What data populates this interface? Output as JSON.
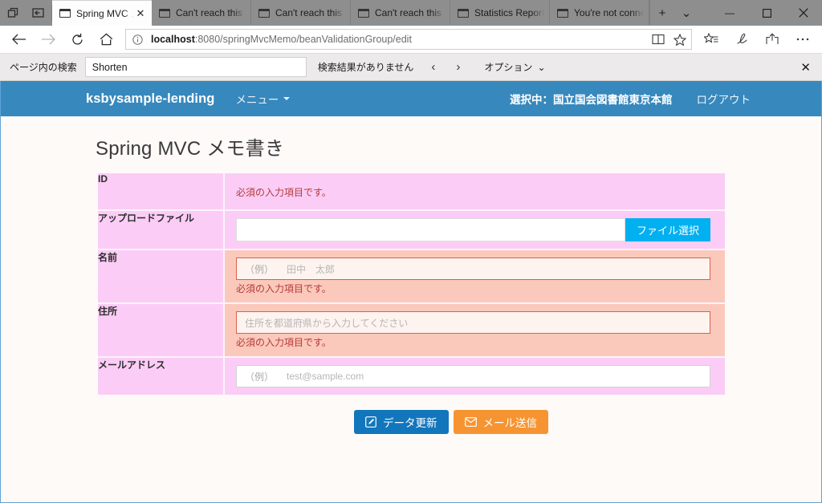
{
  "browser": {
    "system_icons": [
      "restore-window-icon",
      "back-to-tabs-icon"
    ],
    "tabs": [
      {
        "title": "Spring MVC メ",
        "active": true,
        "icon": "page-icon",
        "close_label": "✕"
      },
      {
        "title": "Can't reach this pa",
        "active": false,
        "icon": "page-icon"
      },
      {
        "title": "Can't reach this pa",
        "active": false,
        "icon": "page-icon"
      },
      {
        "title": "Can't reach this pa",
        "active": false,
        "icon": "page-icon"
      },
      {
        "title": "Statistics Report fo",
        "active": false,
        "icon": "page-icon"
      },
      {
        "title": "You're not connec",
        "active": false,
        "icon": "page-icon"
      }
    ],
    "new_tab_label": "+",
    "tab_menu_label": "⌄",
    "window_controls": {
      "minimize": "—",
      "maximize": "❐",
      "close": "✕"
    },
    "nav": {
      "back": "←",
      "forward": "→",
      "refresh": "↻",
      "home": "⌂",
      "info_icon": "ⓘ",
      "url_host": "localhost",
      "url_rest": ":8080/springMvcMemo/beanValidationGroup/edit",
      "reading_view_icon": "book-icon",
      "favorite_icon": "star-icon",
      "favorites_hub_icon": "favorites-hub-icon",
      "notes_icon": "pen-icon",
      "share_icon": "share-icon",
      "settings_icon": "more-icon"
    },
    "find": {
      "label": "ページ内の検索",
      "value": "Shorten",
      "placeholder": "ページ内の検索",
      "status": "検索結果がありません",
      "prev": "‹",
      "next": "›",
      "options_label": "オプション",
      "options_caret": "⌄",
      "close": "✕"
    }
  },
  "app": {
    "brand": "ksbysample-lending",
    "menu_label": "メニュー",
    "selected_library": "選択中：国立国会図書館東京本館",
    "logout_label": "ログアウト",
    "accent_color": "#3788bd"
  },
  "page": {
    "title": "Spring MVC メモ書き",
    "form": {
      "rows": [
        {
          "label": "ID",
          "type": "error-only",
          "error": "必須の入力項目です。"
        },
        {
          "label": "アップロードファイル",
          "type": "file",
          "value": "",
          "button_label": "ファイル選択",
          "button_color": "#00b0f0"
        },
        {
          "label": "名前",
          "type": "text",
          "value": "",
          "placeholder_prefix": "（例）",
          "placeholder": "田中　太郎",
          "error": "必須の入力項目です。",
          "invalid": true
        },
        {
          "label": "住所",
          "type": "text",
          "value": "",
          "placeholder_prefix": "",
          "placeholder": "住所を都道府県から入力してください",
          "error": "必須の入力項目です。",
          "invalid": true
        },
        {
          "label": "メールアドレス",
          "type": "text",
          "value": "",
          "placeholder_prefix": "（例）",
          "placeholder": "test@sample.com",
          "error": "",
          "invalid": false
        }
      ]
    },
    "buttons": [
      {
        "label": "データ更新",
        "icon": "edit-square-icon",
        "color": "#1276bc"
      },
      {
        "label": "メール送信",
        "icon": "envelope-icon",
        "color": "#f79432"
      }
    ]
  }
}
